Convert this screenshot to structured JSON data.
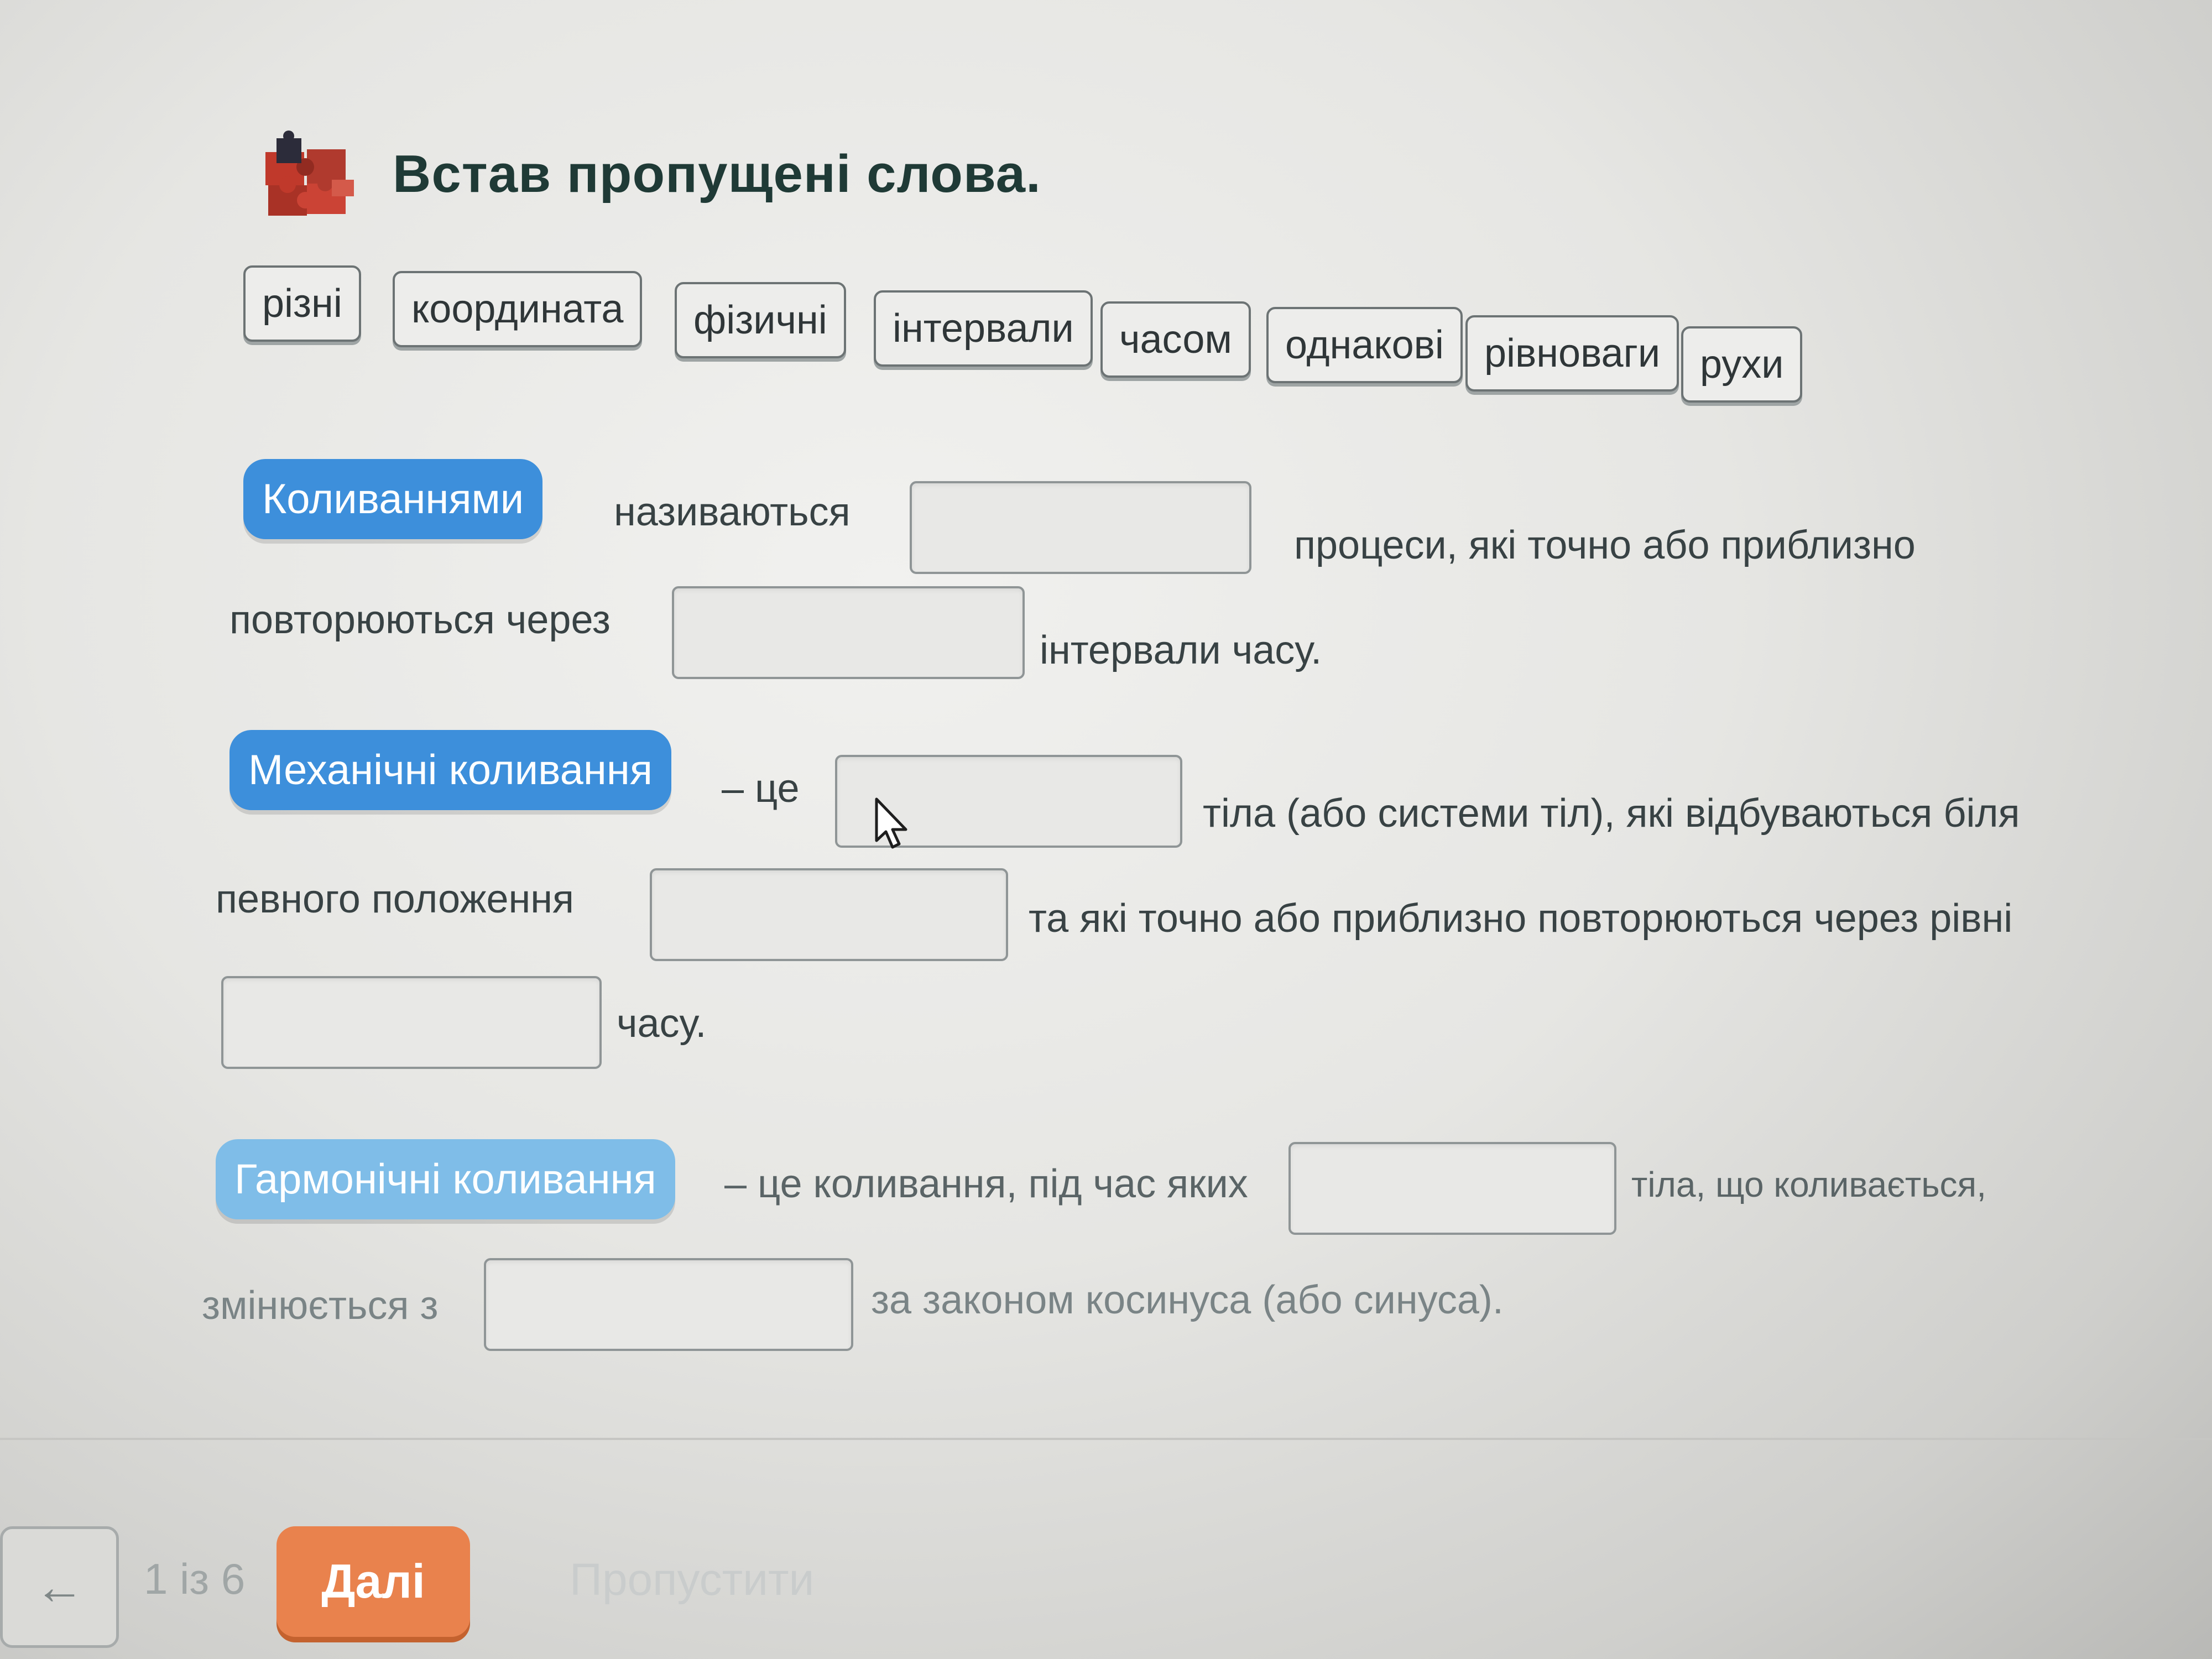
{
  "header": {
    "title": "Встав пропущені слова."
  },
  "word_bank": [
    "різні",
    "координата",
    "фізичні",
    "інтервали",
    "часом",
    "однакові",
    "рівноваги",
    "рухи"
  ],
  "paragraphs": {
    "p1": {
      "term": "Коливаннями",
      "t1": "називаються",
      "t2": "процеси,   які   точно   або   приблизно",
      "t3": "повторюються через",
      "t4": "інтервали часу."
    },
    "p2": {
      "term": "Механічні коливання",
      "t1": "– це",
      "t2": "тіла (або системи тіл), які відбуваються біля",
      "t3": "певного положення",
      "t4": "та які точно або приблизно повторюються через рівні",
      "t5": "часу."
    },
    "p3": {
      "term": "Гармонічні коливання",
      "t1": "– це коливання, під час яких",
      "t2": "тіла, що коливається,",
      "t3": "змінюється з",
      "t4": "за законом косинуса (або синуса)."
    }
  },
  "footer": {
    "back_label": "←",
    "counter": "1 із 6",
    "next_label": "Далі",
    "skip_label": "Пропустити"
  },
  "colors": {
    "term_dark": "#3d8fdb",
    "term_light": "#7fbde8",
    "next_button": "#e9824d",
    "title": "#1f3a36"
  },
  "icons": {
    "header": "puzzle-icon",
    "pointer": "cursor-icon"
  }
}
